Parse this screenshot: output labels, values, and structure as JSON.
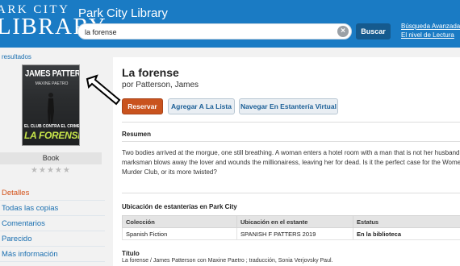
{
  "header": {
    "logo_line1": "ARK CITY",
    "logo_line2": "LIBRARY",
    "app_title": "Park City Library",
    "search_value": "la forense",
    "search_button": "Buscar",
    "links": [
      "Búsqueda Avanzada",
      "El nivel de Lectura"
    ],
    "color": "#1a7bc4"
  },
  "sidebar": {
    "breadcrumb": "resultados",
    "cover": {
      "author": "JAMES PATTERSON",
      "coauthor": "MAXINE PAETRO",
      "subtitle": "EL CLUB CONTRA EL CRIMEN",
      "title": "LA FORENSE"
    },
    "format": "Book",
    "rating_stars": 5,
    "rating_value": 0,
    "nav": [
      {
        "label": "Detalles",
        "active": true
      },
      {
        "label": "Todas las copias",
        "active": false
      },
      {
        "label": "Comentarios",
        "active": false
      },
      {
        "label": "Parecido",
        "active": false
      },
      {
        "label": "Más información",
        "active": false
      }
    ]
  },
  "record": {
    "title": "La forense",
    "author": "por Patterson, James",
    "buttons": {
      "reserve": "Reservar",
      "add_list": "Agregar A La Lista",
      "shelf_nav": "Navegar En Estantería Virtual"
    },
    "summary_heading": "Resumen",
    "summary_lines": [
      "Two bodies arrived at the morgue, one still breathing. A woman enters a hotel room with a man that is not her husband. A",
      "marksman blows away the lover and wounds the millionairess, leaving her for dead. Is it the perfect case for the Women's",
      "Murder Club, or its more twisted?"
    ],
    "shelf_heading": "Ubicación de estanterías en Park City",
    "shelf_columns": [
      "Colección",
      "Ubicación en el estante",
      "Estatus"
    ],
    "shelf_rows": [
      {
        "collection": "Spanish Fiction",
        "location": "SPANISH F PATTERS 2019",
        "status": "En la biblioteca"
      }
    ],
    "title_heading": "Título",
    "title_statement": "La forense / James Patterson con Maxine Paetro ; traducción, Sonia Verjovsky Paul."
  },
  "colors": {
    "accent": "#1a7bc4",
    "reserve": "#c9531e",
    "available": "#2e8b2e"
  }
}
